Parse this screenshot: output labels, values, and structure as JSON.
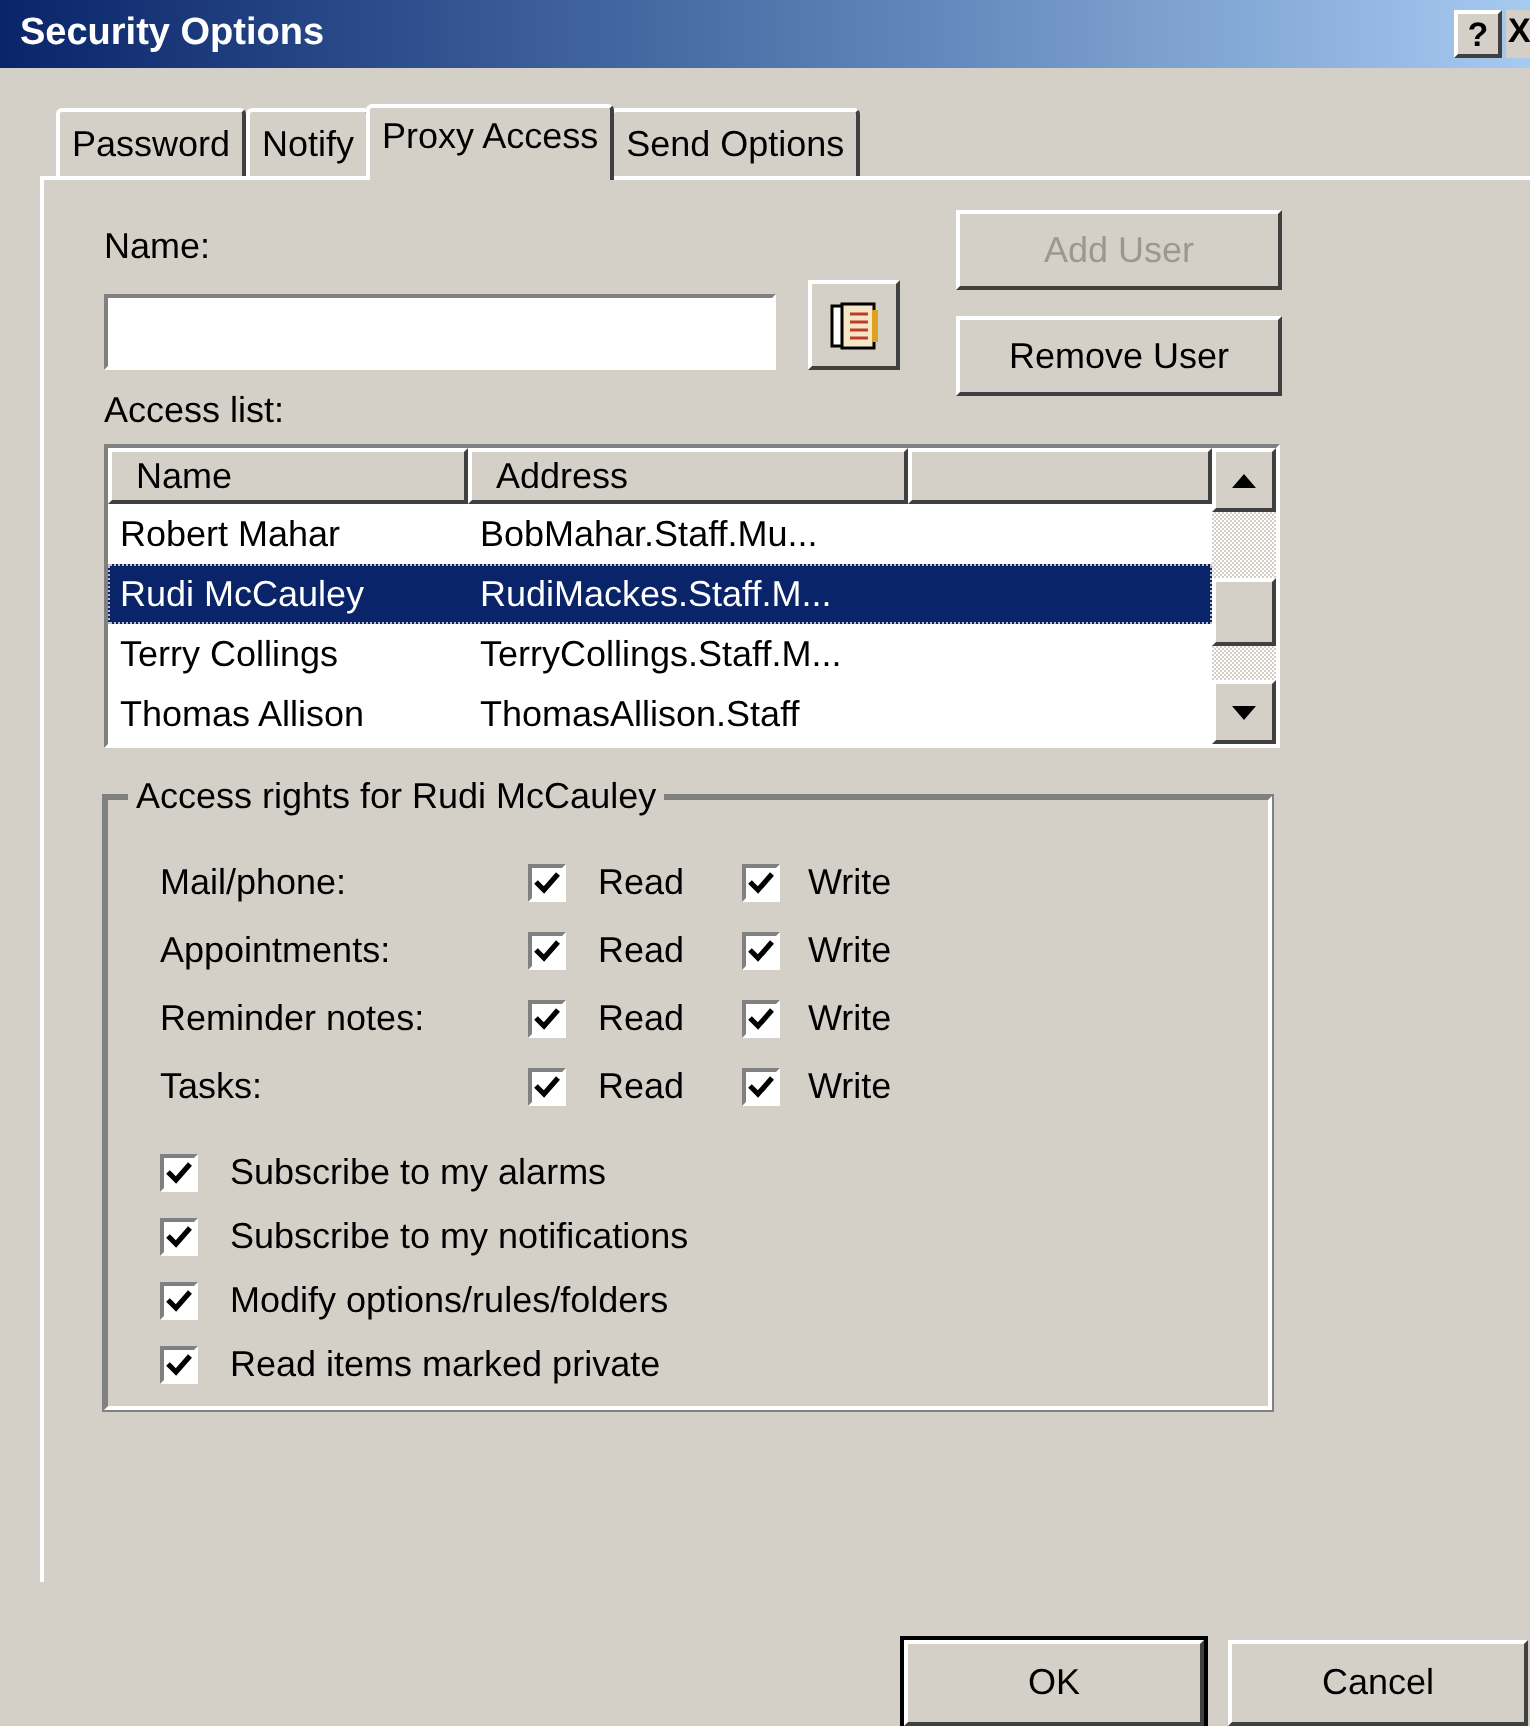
{
  "window": {
    "title": "Security Options",
    "help_button": "?",
    "close_button": "X"
  },
  "tabs": [
    {
      "label": "Password",
      "selected": false
    },
    {
      "label": "Notify",
      "selected": false
    },
    {
      "label": "Proxy Access",
      "selected": true
    },
    {
      "label": "Send Options",
      "selected": false
    }
  ],
  "name_field": {
    "label": "Name:"
  },
  "buttons": [
    {
      "label": "Add User",
      "disabled": true
    },
    {
      "label": "Remove User",
      "disabled": false
    }
  ],
  "access_list": {
    "label": "Access list:",
    "columns": [
      "Name",
      "Address"
    ],
    "rows": [
      {
        "name": "Robert Mahar",
        "address": "BobMahar.Staff.Mu...",
        "selected": false
      },
      {
        "name": "Rudi McCauley",
        "address": "RudiMackes.Staff.M...",
        "selected": true
      },
      {
        "name": "Terry Collings",
        "address": "TerryCollings.Staff.M...",
        "selected": false
      },
      {
        "name": "Thomas Allison",
        "address": "ThomasAllison.Staff",
        "selected": false
      }
    ]
  },
  "access_rights": {
    "title": "Access rights for Rudi McCauley",
    "items": [
      {
        "label": "Mail/phone:",
        "read": {
          "label": "Read",
          "checked": true
        },
        "write": {
          "label": "Write",
          "checked": true
        }
      },
      {
        "label": "Appointments:",
        "read": {
          "label": "Read",
          "checked": true
        },
        "write": {
          "label": "Write",
          "checked": true
        }
      },
      {
        "label": "Reminder notes:",
        "read": {
          "label": "Read",
          "checked": true
        },
        "write": {
          "label": "Write",
          "checked": true
        }
      },
      {
        "label": "Tasks:",
        "read": {
          "label": "Read",
          "checked": true
        },
        "write": {
          "label": "Write",
          "checked": true
        }
      }
    ],
    "options": [
      {
        "label": "Subscribe to my alarms",
        "checked": true
      },
      {
        "label": "Subscribe to my notifications",
        "checked": true
      },
      {
        "label": "Modify options/rules/folders",
        "checked": true
      },
      {
        "label": "Read items marked private",
        "checked": true
      }
    ]
  },
  "footer_buttons": [
    "OK",
    "Cancel"
  ]
}
